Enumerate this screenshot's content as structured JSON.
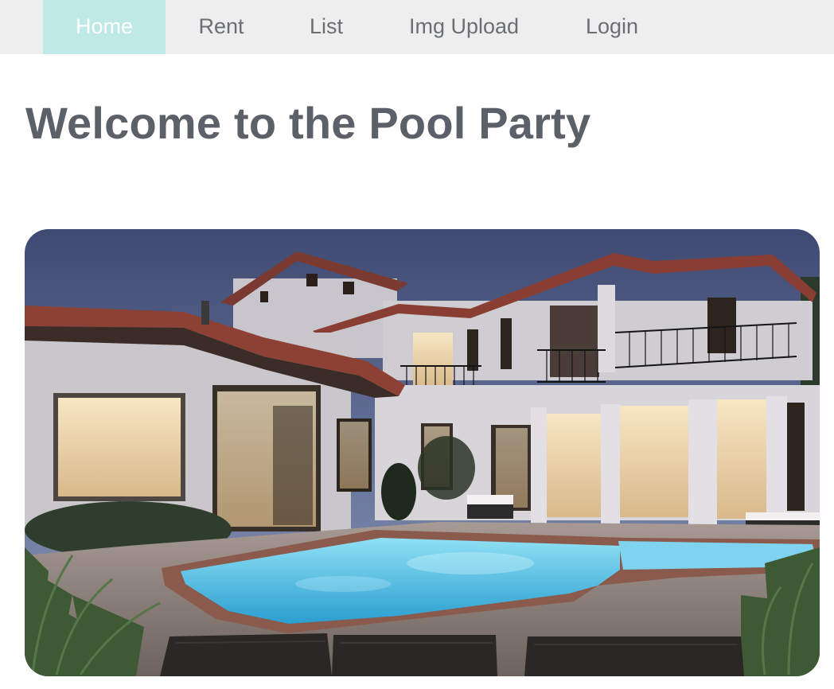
{
  "nav": {
    "items": [
      {
        "label": "Home",
        "active": true
      },
      {
        "label": "Rent",
        "active": false
      },
      {
        "label": "List",
        "active": false
      },
      {
        "label": "Img Upload",
        "active": false
      },
      {
        "label": "Login",
        "active": false
      }
    ],
    "active_color": "#bfe9e6",
    "bar_color": "#eeeeee"
  },
  "main": {
    "title": "Welcome to the Pool Party"
  },
  "hero_image": {
    "subject": "luxury-villa-with-pool-at-dusk"
  }
}
